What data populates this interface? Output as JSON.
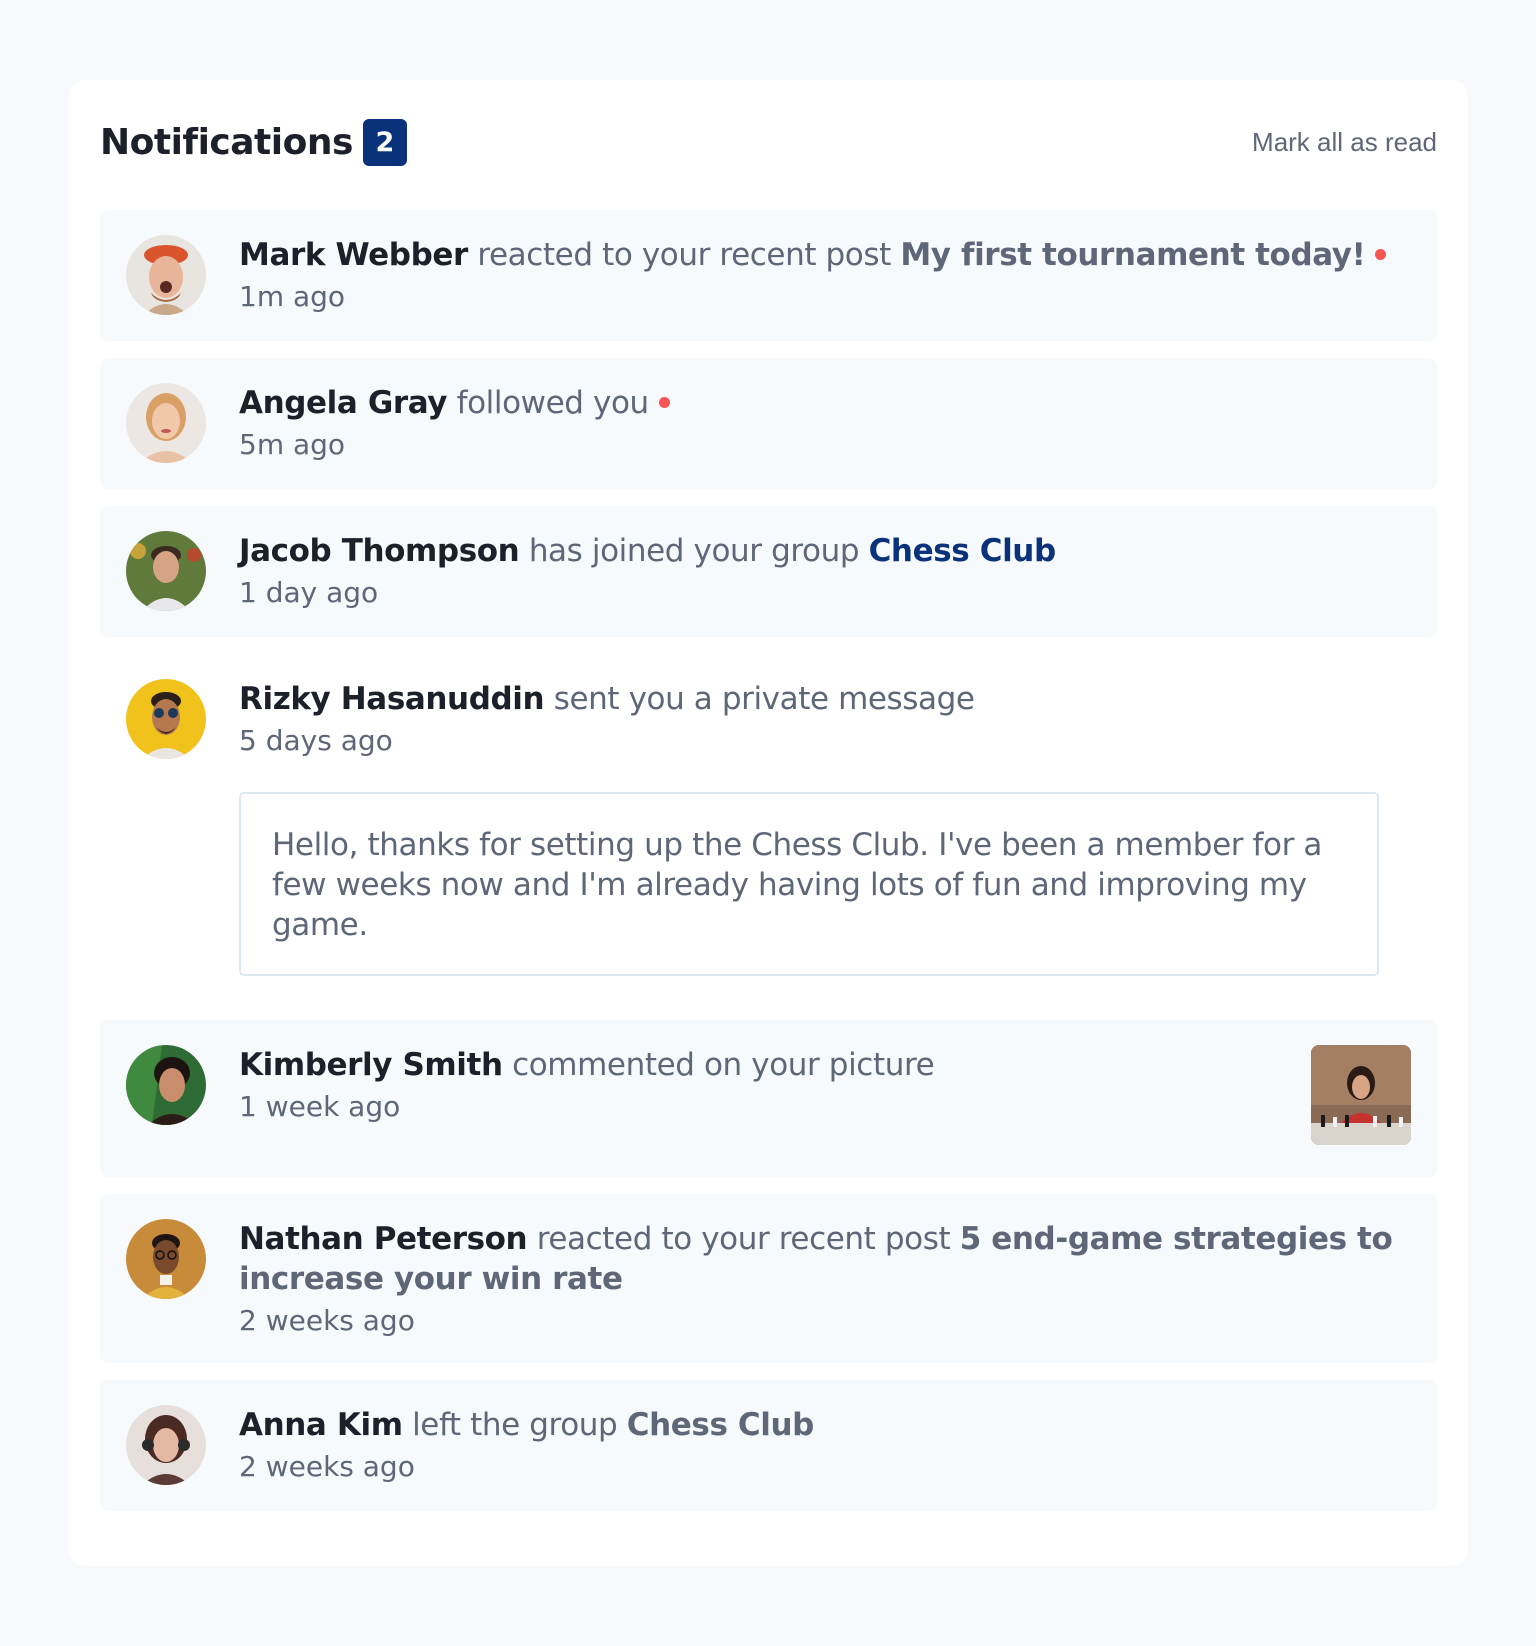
{
  "header": {
    "title": "Notifications",
    "unread_count": "2",
    "mark_all_label": "Mark all as read"
  },
  "notifications": [
    {
      "name": "Mark Webber",
      "action": "reacted to your recent post",
      "post": "My first tournament today!",
      "time": "1m ago",
      "unread": true
    },
    {
      "name": "Angela Gray",
      "action": "followed you",
      "time": "5m ago",
      "unread": true
    },
    {
      "name": "Jacob Thompson",
      "action": "has joined your group",
      "group": "Chess Club",
      "time": "1 day ago",
      "unread": false
    },
    {
      "name": "Rizky Hasanuddin",
      "action": "sent you a private message",
      "time": "5 days ago",
      "message": "Hello, thanks for setting up the Chess Club. I've been a member for a few weeks now and I'm already having lots of fun and improving my game.",
      "unread": false
    },
    {
      "name": "Kimberly Smith",
      "action": "commented on your picture",
      "time": "1 week ago",
      "unread": false
    },
    {
      "name": "Nathan Peterson",
      "action": "reacted to your recent post",
      "post": "5 end-game strategies to increase your win rate",
      "time": "2 weeks ago",
      "unread": false
    },
    {
      "name": "Anna Kim",
      "action": "left the group",
      "group": "Chess Club",
      "time": "2 weeks ago",
      "unread": false
    }
  ],
  "colors": {
    "page_bg": "#f7f9fc",
    "card_bg": "#ffffff",
    "unread_bg": "#f7fafd",
    "badge": "#0a327b",
    "dot": "#f65552",
    "text_dark": "#1c202b",
    "text_grey": "#5e6778",
    "link_blue": "#0a327b"
  }
}
